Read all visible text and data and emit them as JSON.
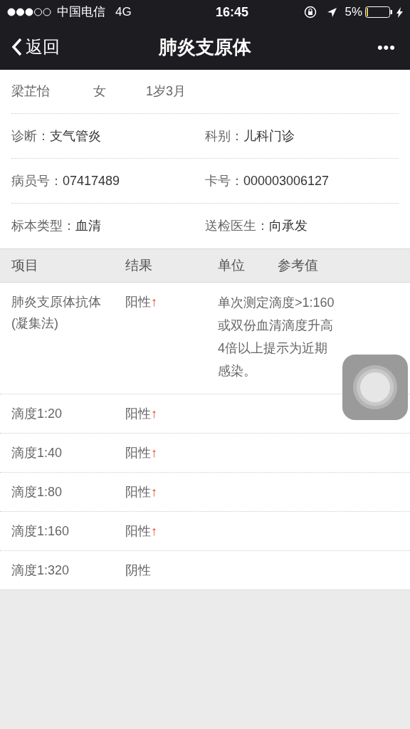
{
  "status_bar": {
    "carrier": "中国电信",
    "network": "4G",
    "time": "16:45",
    "battery": "5%"
  },
  "nav": {
    "back": "返回",
    "title": "肺炎支原体",
    "more": "•••"
  },
  "patient": {
    "name": "梁芷怡",
    "sex": "女",
    "age": "1岁3月"
  },
  "info": [
    [
      {
        "label": "诊断：",
        "value": "支气管炎"
      },
      {
        "label": "科别：",
        "value": "儿科门诊"
      }
    ],
    [
      {
        "label": "病员号：",
        "value": "07417489"
      },
      {
        "label": "卡号：",
        "value": "000003006127"
      }
    ],
    [
      {
        "label": "标本类型：",
        "value": "血清"
      },
      {
        "label": "送检医生：",
        "value": "向承发"
      }
    ]
  ],
  "table": {
    "columns": [
      "项目",
      "结果",
      "单位",
      "参考值"
    ],
    "rows": [
      {
        "item": "肺炎支原体抗体(凝集法)",
        "result": "阳性",
        "flag": "↑",
        "reference": "单次测定滴度>1:160或双份血清滴度升高4倍以上提示为近期感染。"
      },
      {
        "item": "滴度1:20",
        "result": "阳性",
        "flag": "↑"
      },
      {
        "item": "滴度1:40",
        "result": "阳性",
        "flag": "↑"
      },
      {
        "item": "滴度1:80",
        "result": "阳性",
        "flag": "↑"
      },
      {
        "item": "滴度1:160",
        "result": "阳性",
        "flag": "↑"
      },
      {
        "item": "滴度1:320",
        "result": "阴性"
      }
    ]
  }
}
